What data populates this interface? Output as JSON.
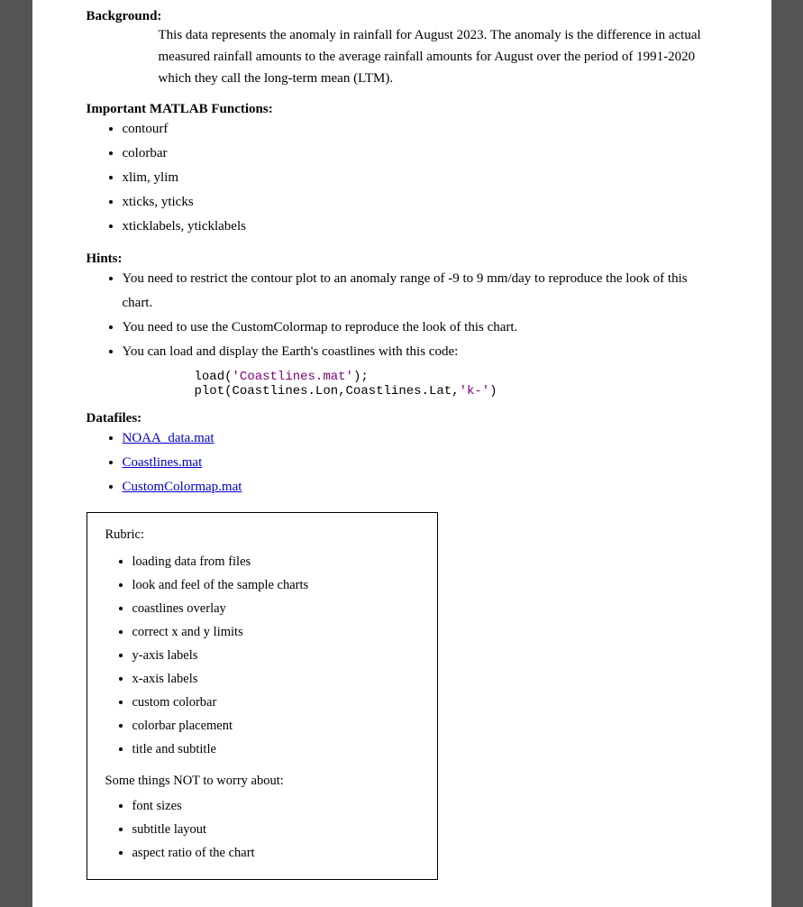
{
  "background_label": "Background:",
  "background_text": "This data represents the anomaly in rainfall for August 2023. The anomaly is the difference in actual measured rainfall amounts to the average rainfall amounts for August over the period of 1991-2020 which they call the long-term mean (LTM).",
  "matlab_label": "Important MATLAB Functions:",
  "matlab_functions": [
    "contourf",
    "colorbar",
    "xlim, ylim",
    "xticks, yticks",
    "xticklabels, yticklabels"
  ],
  "hints_label": "Hints:",
  "hints": [
    "You need to restrict the contour plot to an anomaly range of -9 to 9 mm/day to reproduce the look of this chart.",
    "You need to use the CustomColormap to reproduce the look of this chart.",
    "You can load and display the Earth's coastlines with this code:"
  ],
  "code_line1": "load(",
  "code_string1": "'Coastlines.mat'",
  "code_end1": ");",
  "code_line2_prefix": "plot(Coastlines.Lon,Coastlines.Lat,",
  "code_string2": "'k-'",
  "code_line2_suffix": ")",
  "datafiles_label": "Datafiles:",
  "datafiles": [
    "NOAA_data.mat",
    "Coastlines.mat",
    "CustomColormap.mat"
  ],
  "rubric_title": "Rubric:",
  "rubric_items": [
    "loading data from files",
    "look and feel of the sample charts",
    "coastlines overlay",
    "correct x and y limits",
    "y-axis labels",
    "x-axis labels",
    "custom colorbar",
    "colorbar placement",
    "title and subtitle"
  ],
  "not_worry_label": "Some things NOT to worry about:",
  "not_worry_items": [
    "font sizes",
    "subtitle layout",
    "aspect ratio of the chart"
  ]
}
